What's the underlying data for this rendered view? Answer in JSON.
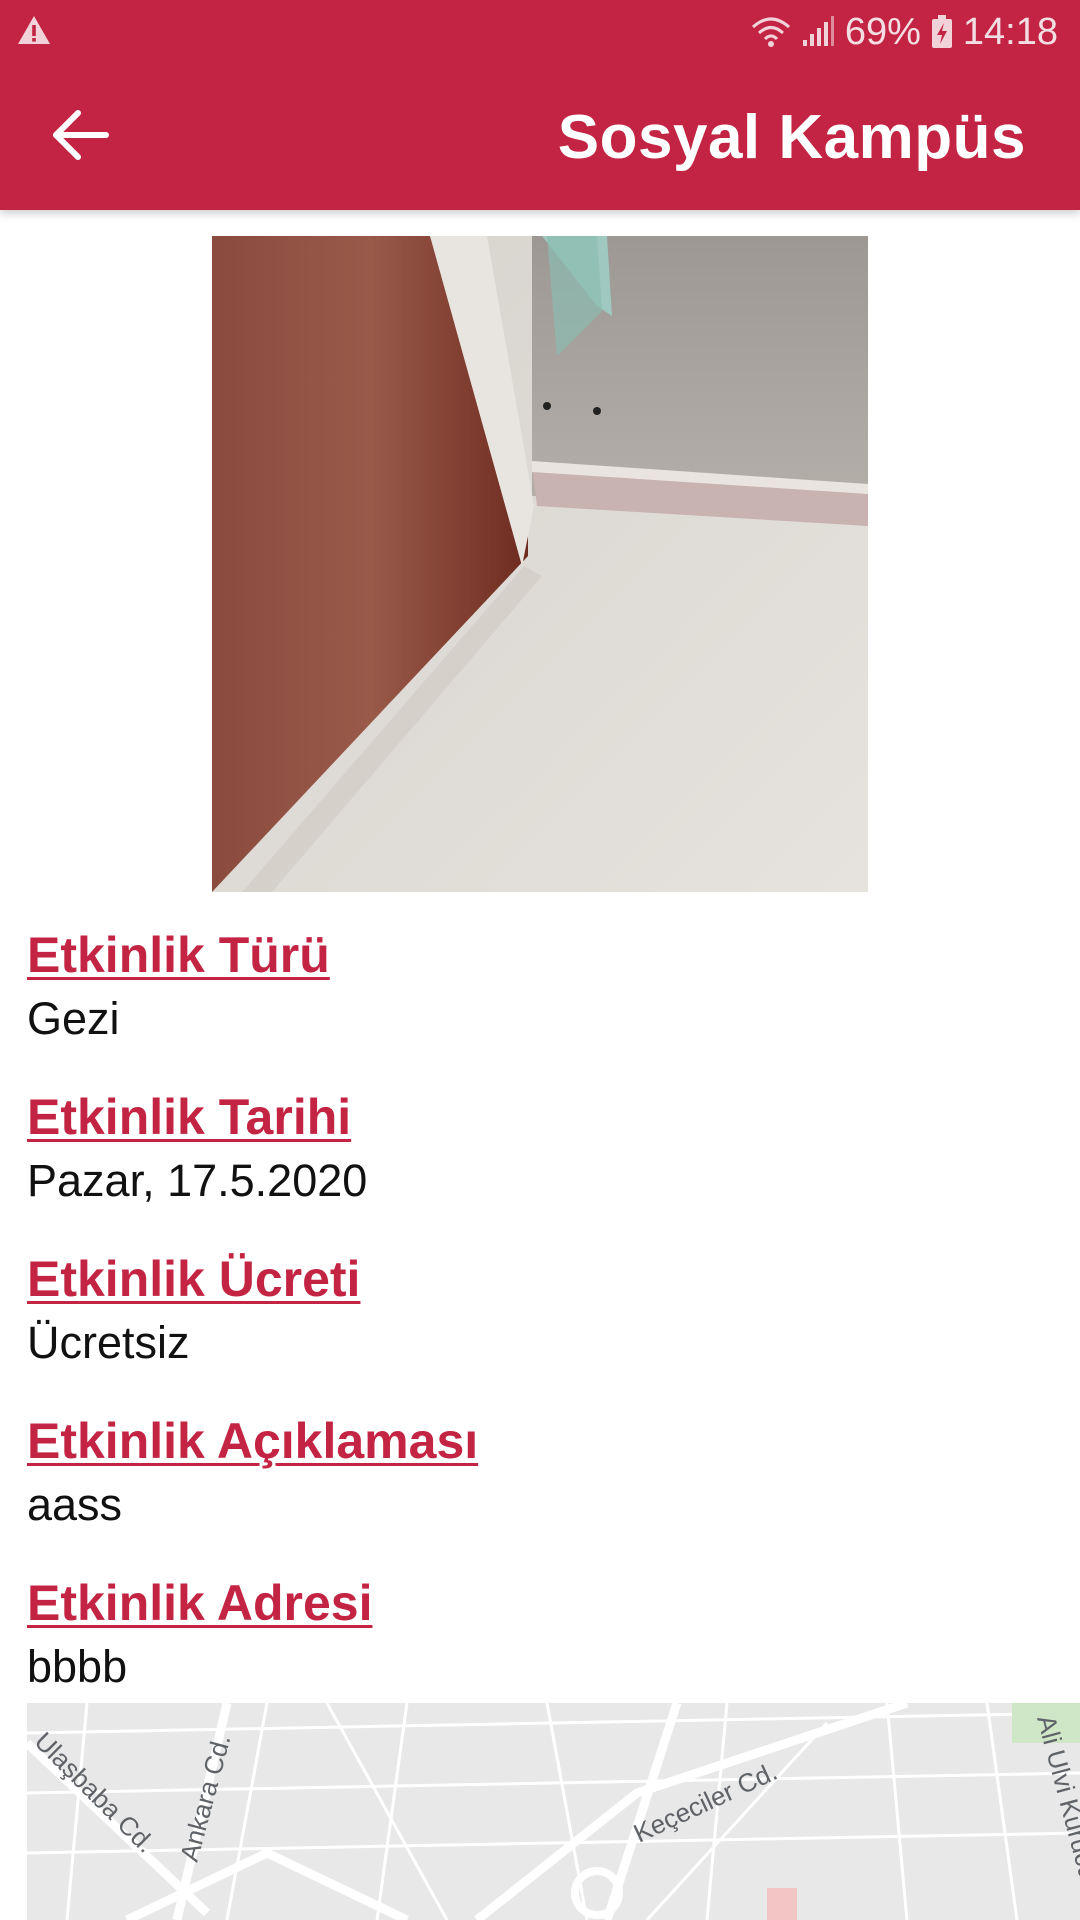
{
  "status_bar": {
    "warning_icon": "warning-triangle-icon",
    "battery_percent": "69%",
    "time": "14:18",
    "icons": [
      "wifi-icon",
      "signal-icon",
      "battery-charging-icon"
    ]
  },
  "toolbar": {
    "back_icon": "arrow-left-icon",
    "title": "Sosyal Kampüs",
    "color": "#c42443"
  },
  "event": {
    "fields": [
      {
        "label": "Etkinlik Türü",
        "value": "Gezi"
      },
      {
        "label": "Etkinlik Tarihi",
        "value": "Pazar, 17.5.2020"
      },
      {
        "label": "Etkinlik Ücreti",
        "value": "Ücretsiz"
      },
      {
        "label": "Etkinlik Açıklaması",
        "value": "aass"
      },
      {
        "label": "Etkinlik Adresi",
        "value": "bbbb"
      }
    ]
  },
  "map": {
    "streets": [
      "Ulaşbaba Cd.",
      "Ankara Cd.",
      "Keçeciler Cd.",
      "Ali Ulvi Kurucu"
    ]
  }
}
